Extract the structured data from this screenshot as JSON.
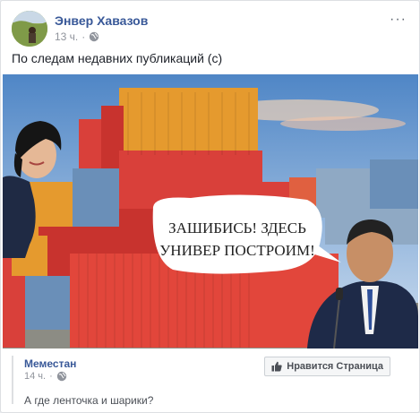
{
  "post": {
    "author": "Энвер Хавазов",
    "time": "13 ч.",
    "privacy_icon": "globe-icon",
    "more_icon": "more-icon",
    "more_label": "···",
    "caption": "По следам недавних публикаций (с)"
  },
  "image": {
    "bubble_line1": "ЗАШИБИСЬ! ЗДЕСЬ",
    "bubble_line2": "УНИВЕР ПОСТРОИМ!"
  },
  "shared_post": {
    "page_name": "Меместан",
    "time": "14 ч.",
    "like_button_label": "Нравится Страница",
    "text": "А где ленточка и шарики?"
  },
  "colors": {
    "link_blue": "#385898",
    "meta_gray": "#90949c",
    "container_red": "#d9403a",
    "container_orange": "#e59a2e",
    "container_blue": "#6a8fb8"
  }
}
